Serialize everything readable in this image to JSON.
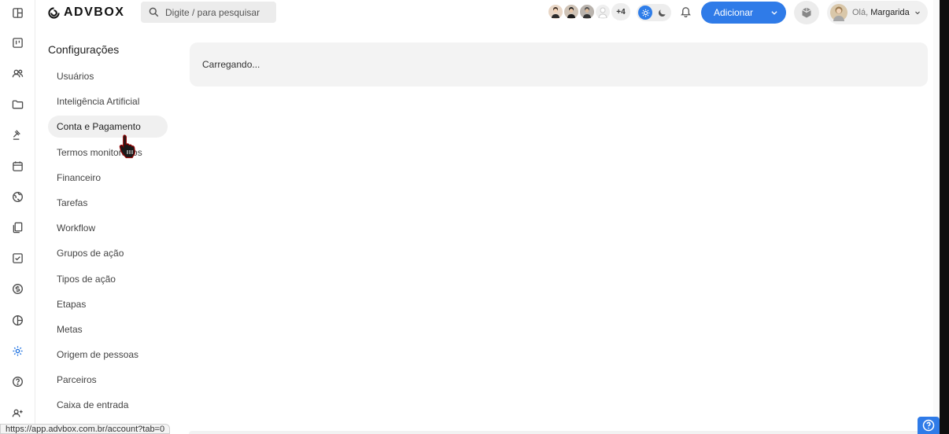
{
  "header": {
    "brand": "ADVBOX",
    "search_placeholder": "Digite / para pesquisar",
    "avatars_more": "+4",
    "add_button_label": "Adicionar",
    "greeting": "Olá,",
    "user_name": "Margarida"
  },
  "settings": {
    "title": "Configurações",
    "items": [
      {
        "label": "Usuários"
      },
      {
        "label": "Inteligência Artificial"
      },
      {
        "label": "Conta e Pagamento"
      },
      {
        "label": "Termos monitorados"
      },
      {
        "label": "Financeiro"
      },
      {
        "label": "Tarefas"
      },
      {
        "label": "Workflow"
      },
      {
        "label": "Grupos de ação"
      },
      {
        "label": "Tipos de ação"
      },
      {
        "label": "Etapas"
      },
      {
        "label": "Metas"
      },
      {
        "label": "Origem de pessoas"
      },
      {
        "label": "Parceiros"
      },
      {
        "label": "Caixa de entrada"
      }
    ],
    "active_index": 2
  },
  "content": {
    "loading_text": "Carregando..."
  },
  "status_bar": {
    "url": "https://app.advbox.com.br/account?tab=0"
  },
  "colors": {
    "accent": "#2f7be8",
    "active_rail_icon": "#1a6fe0",
    "panel_bg": "#f3f3f3"
  },
  "rail_icons": [
    "layout-icon",
    "kanban-icon",
    "people-icon",
    "folder-icon",
    "gavel-icon",
    "calendar-icon",
    "globe-icon",
    "documents-icon",
    "checkbox-icon",
    "dollar-icon",
    "chart-pie-icon",
    "gear-icon",
    "help-icon",
    "add-user-icon"
  ]
}
